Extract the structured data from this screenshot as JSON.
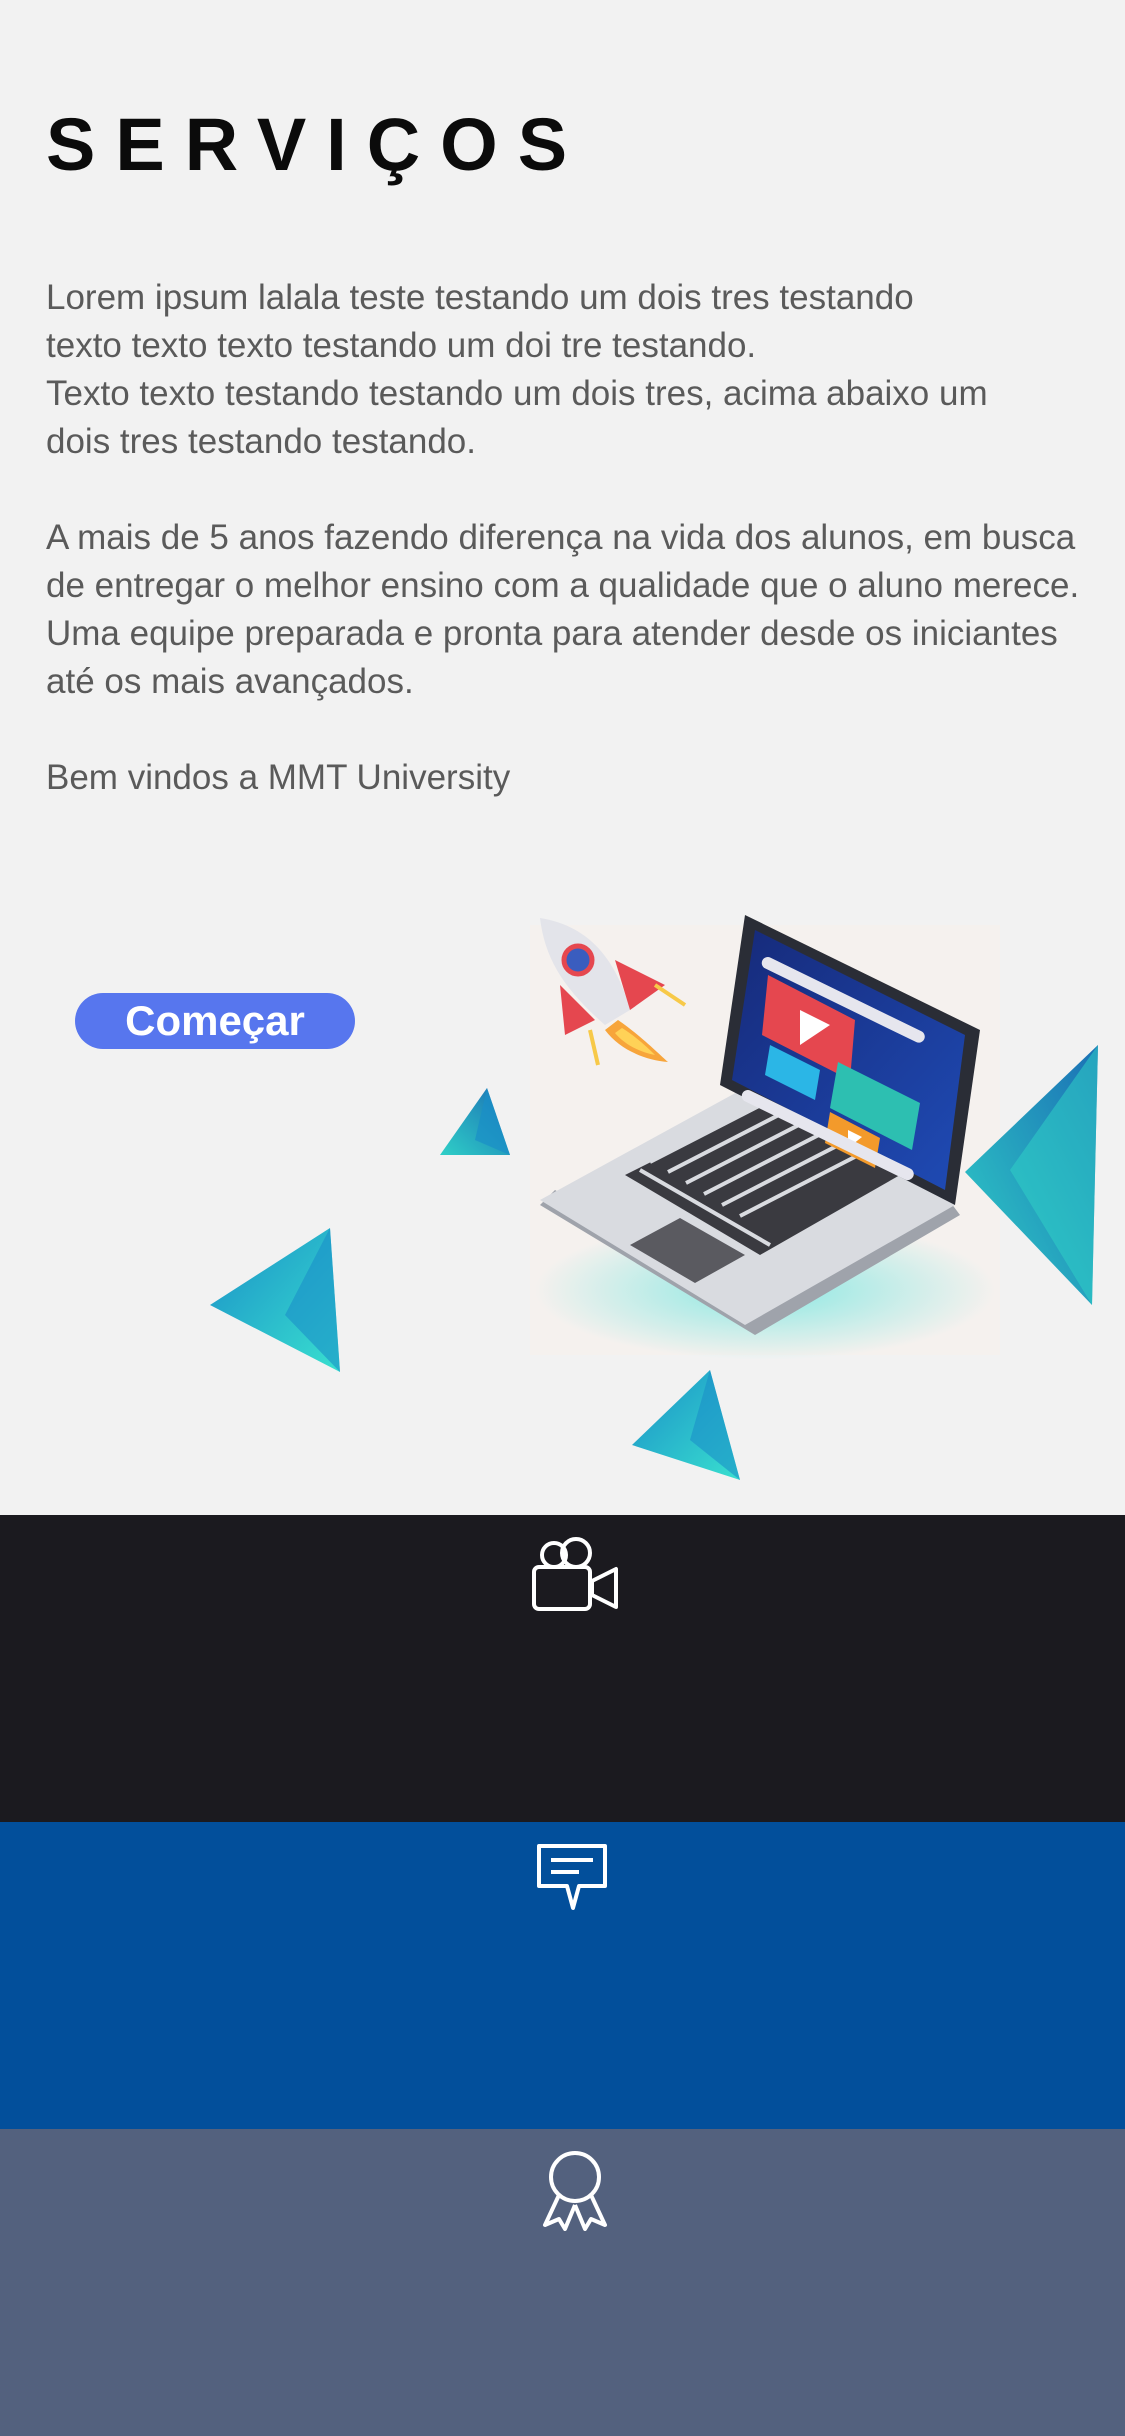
{
  "page": {
    "title": "SERVIÇOS",
    "paragraphs": [
      "Lorem ipsum lalala teste testando um dois tres testando",
      "texto texto texto testando um doi tre testando.",
      "Texto texto testando testando um dois tres, acima abaixo um",
      "dois tres testando testando.",
      "A mais de 5 anos fazendo diferença na vida dos alunos, em busca",
      "de entregar o melhor ensino com a qualidade que o aluno merece.",
      "Uma equipe preparada e pronta para atender desde os iniciantes",
      "até os mais avançados.",
      "Bem vindos a MMT University"
    ]
  },
  "cta": {
    "label": "Começar",
    "color": "#5776ee"
  },
  "sections": [
    {
      "icon": "video-camera-icon",
      "color": "#1b1a1f"
    },
    {
      "icon": "chat-message-icon",
      "color": "#024f9b"
    },
    {
      "icon": "award-ribbon-icon",
      "color": "#53617e"
    }
  ],
  "colors": {
    "background": "#f2f2f2",
    "text": "#5a5a5a",
    "title": "#0b0b0b",
    "accent_teal": "#2fd0c7"
  }
}
